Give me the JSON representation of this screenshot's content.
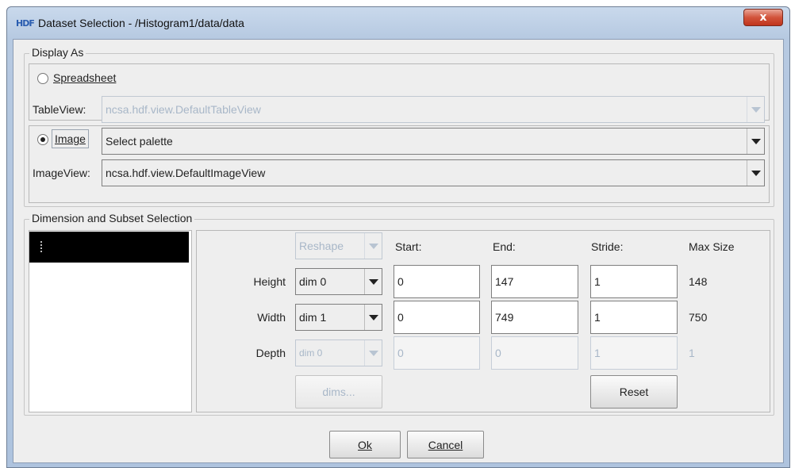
{
  "window": {
    "title": "Dataset Selection - /Histogram1/data/data",
    "app_icon": "hdf-icon",
    "close_label": "x"
  },
  "display_as": {
    "legend": "Display As",
    "spreadsheet_label": "Spreadsheet",
    "spreadsheet_selected": false,
    "tableview_label": "TableView:",
    "tableview_value": "ncsa.hdf.view.DefaultTableView",
    "image_label": "Image",
    "image_selected": true,
    "palette_value": "Select palette",
    "imageview_label": "ImageView:",
    "imageview_value": "ncsa.hdf.view.DefaultImageView"
  },
  "dimension": {
    "legend": "Dimension and Subset Selection",
    "reshape_value": "Reshape",
    "headers": {
      "start": "Start:",
      "end": "End:",
      "stride": "Stride:",
      "max": "Max Size"
    },
    "rows": [
      {
        "label": "Height",
        "dim": "dim 0",
        "start": "0",
        "end": "147",
        "stride": "1",
        "max": "148",
        "enabled": true
      },
      {
        "label": "Width",
        "dim": "dim 1",
        "start": "0",
        "end": "749",
        "stride": "1",
        "max": "750",
        "enabled": true
      },
      {
        "label": "Depth",
        "dim": "dim 0",
        "start": "0",
        "end": "0",
        "stride": "1",
        "max": "1",
        "enabled": false
      }
    ],
    "dims_button": "dims...",
    "reset_button": "Reset"
  },
  "footer": {
    "ok_label": "Ok",
    "cancel_label": "Cancel"
  },
  "colors": {
    "disabled_text": "#a8b7c8",
    "title_gradient": "#b6c9e1",
    "close_red": "#d2543c"
  }
}
